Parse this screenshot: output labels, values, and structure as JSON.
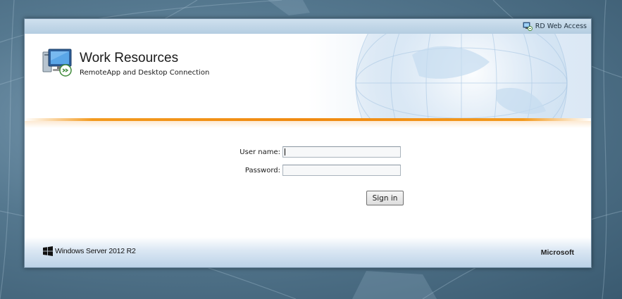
{
  "top_bar": {
    "link_label": "RD Web Access",
    "link_icon": "rd-web-access-icon"
  },
  "header": {
    "app_icon": "remote-desktop-computer-icon",
    "title": "Work Resources",
    "subtitle": "RemoteApp and Desktop Connection"
  },
  "login_form": {
    "username_label": "User name:",
    "username_value": "",
    "password_label": "Password:",
    "password_value": "",
    "sign_in_label": "Sign in"
  },
  "footer": {
    "product_logo": "windows-logo-icon",
    "product_name": "Windows Server 2012 R2",
    "vendor": "Microsoft"
  },
  "colors": {
    "accent_orange": "#f08a10",
    "top_bar_blue": "#b4cde1",
    "background_blue": "#55788f"
  }
}
